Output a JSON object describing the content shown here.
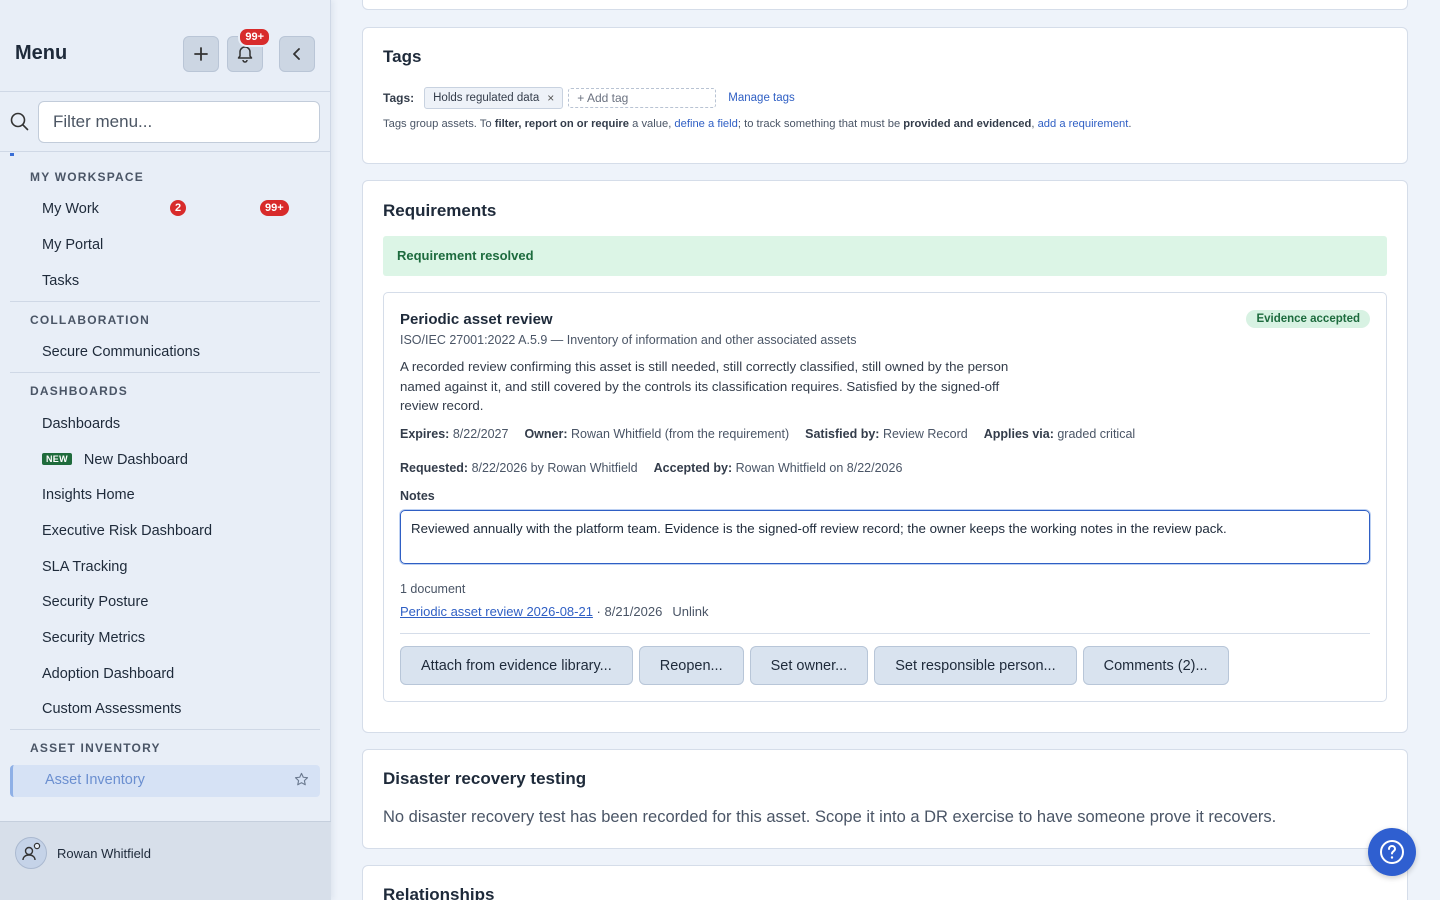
{
  "sidebar": {
    "title": "Menu",
    "notification_count": "99+",
    "filter_placeholder": "Filter menu...",
    "sections": {
      "workspace": "MY WORKSPACE",
      "collaboration": "COLLABORATION",
      "dashboards": "DASHBOARDS",
      "asset_inventory": "ASSET INVENTORY"
    },
    "items": {
      "my_work": "My Work",
      "my_work_badge_a": "2",
      "my_work_badge_b": "99+",
      "my_portal": "My Portal",
      "tasks": "Tasks",
      "secure_comms": "Secure Communications",
      "dashboards": "Dashboards",
      "new_tag": "NEW",
      "new_dashboard": "New Dashboard",
      "insights_home": "Insights Home",
      "exec_risk": "Executive Risk Dashboard",
      "sla_tracking": "SLA Tracking",
      "security_posture": "Security Posture",
      "security_metrics": "Security Metrics",
      "adoption_dashboard": "Adoption Dashboard",
      "custom_assessments": "Custom Assessments",
      "asset_inventory": "Asset Inventory"
    },
    "user_name": "Rowan Whitfield"
  },
  "tags_card": {
    "title": "Tags",
    "label": "Tags:",
    "chip": "Holds regulated data",
    "chip_remove": "×",
    "add_tag": "+ Add tag",
    "manage": "Manage tags",
    "help_1": "Tags group assets. To ",
    "help_b1": "filter, report on or require",
    "help_2": " a value, ",
    "help_link1": "define a field",
    "help_3": "; to track something that must be ",
    "help_b2": "provided and evidenced",
    "help_4": ", ",
    "help_link2": "add a requirement",
    "help_5": "."
  },
  "requirements": {
    "title": "Requirements",
    "resolved_banner": "Requirement resolved",
    "item": {
      "title": "Periodic asset review",
      "status": "Evidence accepted",
      "subtitle": "ISO/IEC 27001:2022 A.5.9 — Inventory of information and other associated assets",
      "description": "A recorded review confirming this asset is still needed, still correctly classified, still owned by the person named against it, and still covered by the controls its classification requires. Satisfied by the signed-off review record.",
      "expires_label": "Expires:",
      "expires": "8/22/2027",
      "owner_label": "Owner:",
      "owner": "Rowan Whitfield (from the requirement)",
      "satisfied_label": "Satisfied by:",
      "satisfied": "Review Record",
      "applies_label": "Applies via:",
      "applies": "graded critical",
      "requested_label": "Requested:",
      "requested": "8/22/2026 by Rowan Whitfield",
      "accepted_label": "Accepted by:",
      "accepted": "Rowan Whitfield on 8/22/2026",
      "notes_label": "Notes",
      "notes": "Reviewed annually with the platform team. Evidence is the signed-off review record; the owner keeps the working notes in the review pack.",
      "doc_count": "1 document",
      "doc_name": "Periodic asset review 2026-08-21",
      "doc_date": " · 8/21/2026",
      "unlink": "Unlink",
      "buttons": {
        "attach": "Attach from evidence library...",
        "reopen": "Reopen...",
        "set_owner": "Set owner...",
        "set_responsible": "Set responsible person...",
        "comments": "Comments (2)..."
      }
    }
  },
  "dr_card": {
    "title": "Disaster recovery testing",
    "text": "No disaster recovery test has been recorded for this asset. Scope it into a DR exercise to have someone prove it recovers."
  },
  "relationships_card": {
    "title": "Relationships"
  },
  "colors": {
    "accent": "#2f5fc4",
    "badge_red": "#d82b2b",
    "success_bg": "#dcf5e6",
    "success_text": "#1d6b3e"
  },
  "icons": [
    "plus-icon",
    "bell-icon",
    "chevron-left-icon",
    "search-icon",
    "star-icon",
    "user-settings-icon",
    "help-icon"
  ]
}
